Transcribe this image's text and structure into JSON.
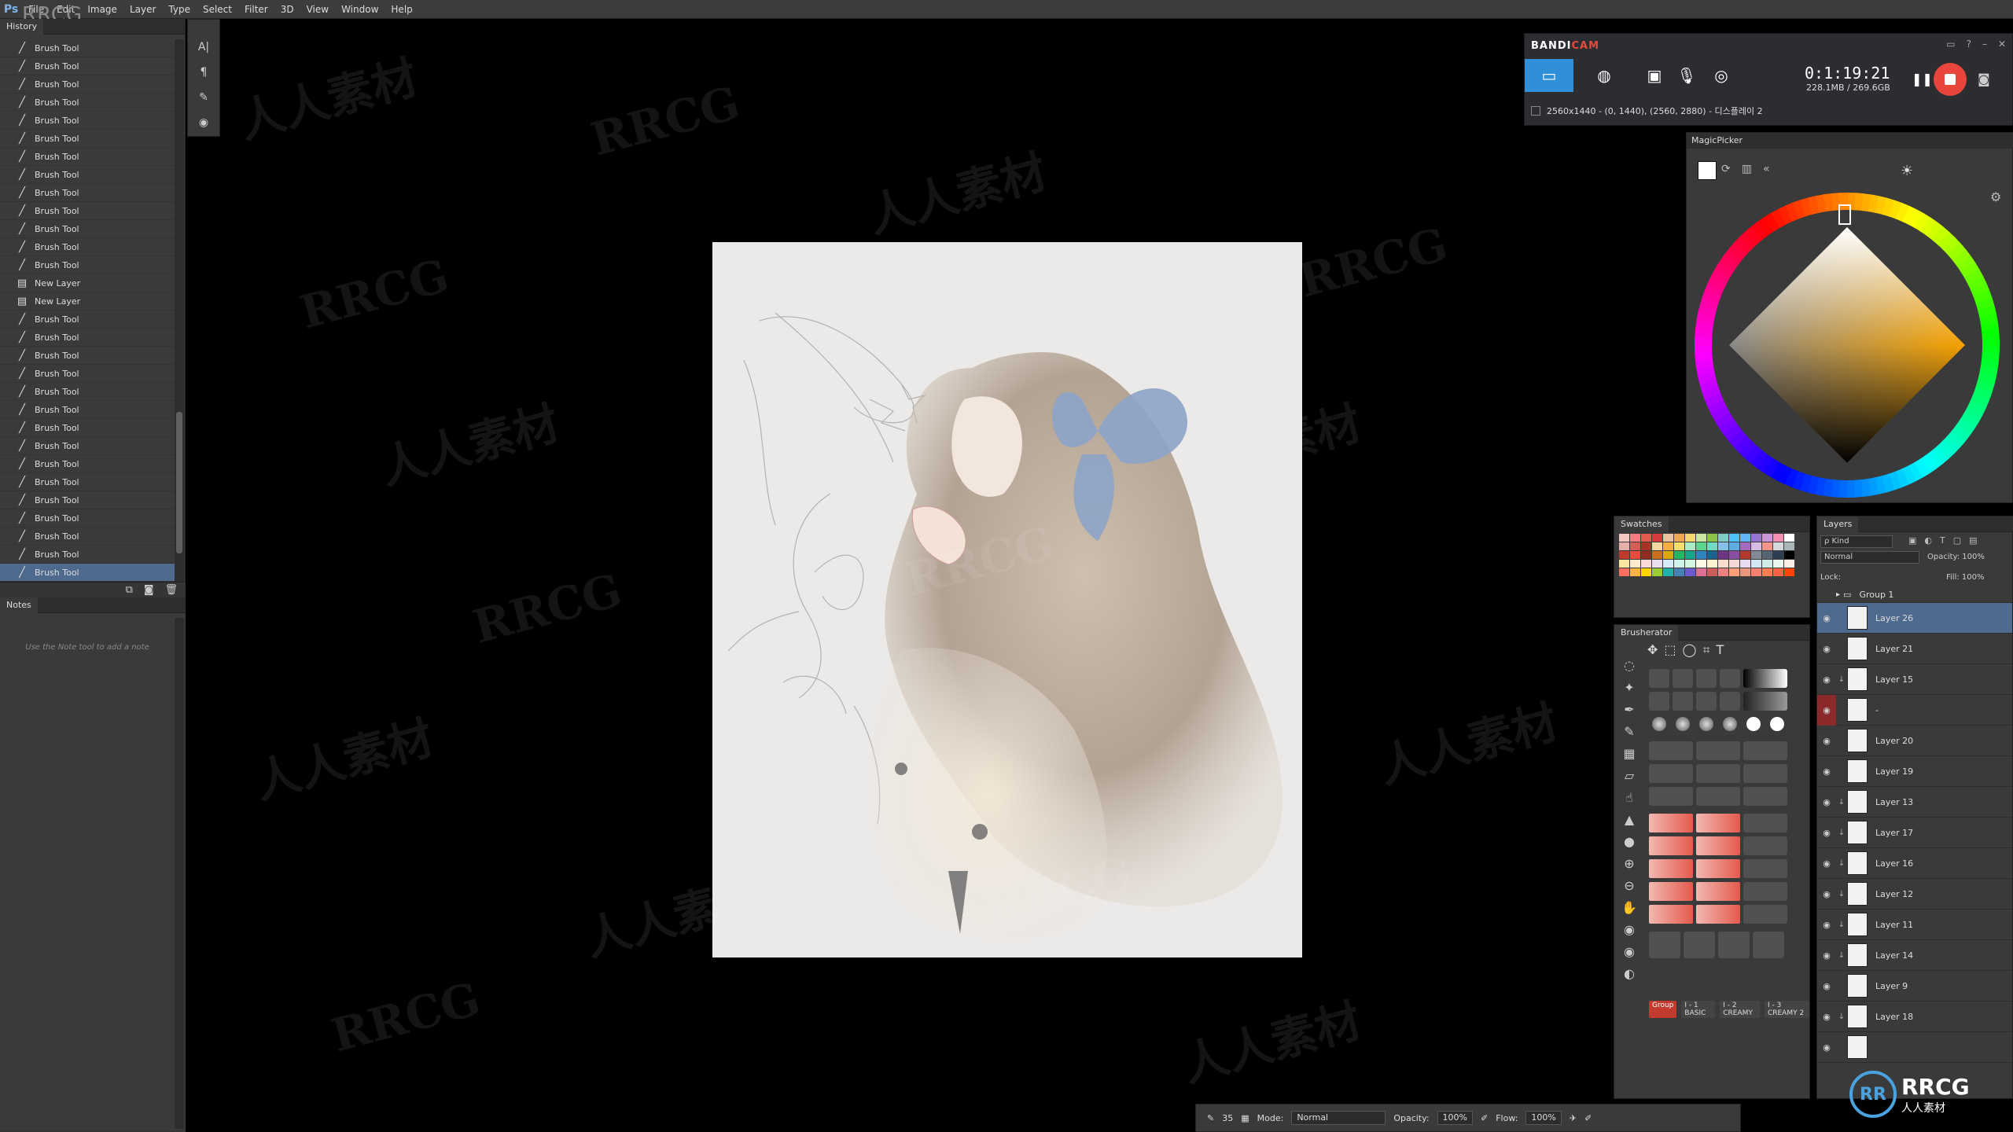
{
  "app": {
    "logo": "Ps",
    "watermark_small": "RRCG"
  },
  "menu": [
    "File",
    "Edit",
    "Image",
    "Layer",
    "Type",
    "Select",
    "Filter",
    "3D",
    "View",
    "Window",
    "Help"
  ],
  "history": {
    "tab_label": "History",
    "items": [
      {
        "label": "Brush Tool",
        "icon": "brush-icon"
      },
      {
        "label": "Brush Tool",
        "icon": "brush-icon"
      },
      {
        "label": "Brush Tool",
        "icon": "brush-icon"
      },
      {
        "label": "Brush Tool",
        "icon": "brush-icon"
      },
      {
        "label": "Brush Tool",
        "icon": "brush-icon"
      },
      {
        "label": "Brush Tool",
        "icon": "brush-icon"
      },
      {
        "label": "Brush Tool",
        "icon": "brush-icon"
      },
      {
        "label": "Brush Tool",
        "icon": "brush-icon"
      },
      {
        "label": "Brush Tool",
        "icon": "brush-icon"
      },
      {
        "label": "Brush Tool",
        "icon": "brush-icon"
      },
      {
        "label": "Brush Tool",
        "icon": "brush-icon"
      },
      {
        "label": "Brush Tool",
        "icon": "brush-icon"
      },
      {
        "label": "Brush Tool",
        "icon": "brush-icon"
      },
      {
        "label": "New Layer",
        "icon": "layer-icon"
      },
      {
        "label": "New Layer",
        "icon": "layer-icon"
      },
      {
        "label": "Brush Tool",
        "icon": "brush-icon"
      },
      {
        "label": "Brush Tool",
        "icon": "brush-icon"
      },
      {
        "label": "Brush Tool",
        "icon": "brush-icon"
      },
      {
        "label": "Brush Tool",
        "icon": "brush-icon"
      },
      {
        "label": "Brush Tool",
        "icon": "brush-icon"
      },
      {
        "label": "Brush Tool",
        "icon": "brush-icon"
      },
      {
        "label": "Brush Tool",
        "icon": "brush-icon"
      },
      {
        "label": "Brush Tool",
        "icon": "brush-icon"
      },
      {
        "label": "Brush Tool",
        "icon": "brush-icon"
      },
      {
        "label": "Brush Tool",
        "icon": "brush-icon"
      },
      {
        "label": "Brush Tool",
        "icon": "brush-icon"
      },
      {
        "label": "Brush Tool",
        "icon": "brush-icon"
      },
      {
        "label": "Brush Tool",
        "icon": "brush-icon"
      },
      {
        "label": "Brush Tool",
        "icon": "brush-icon"
      },
      {
        "label": "Brush Tool",
        "icon": "brush-icon",
        "selected": true
      }
    ]
  },
  "notes": {
    "tab_label": "Notes",
    "hint": "Use the Note tool to add a note"
  },
  "bandicam": {
    "title_a": "BANDI",
    "title_b": "CAM",
    "time": "0:1:19:21",
    "size": "228.1MB / 269.6GB",
    "capture_info": "2560x1440 - (0, 1440), (2560, 2880) - 디스플레이 2"
  },
  "magicpicker": {
    "tab_label": "MagicPicker"
  },
  "swatches": {
    "tab_label": "Swatches",
    "colors": [
      "#f4c7c3",
      "#f08080",
      "#e45a4c",
      "#d63c3c",
      "#e8c4a0",
      "#f2a65a",
      "#f5d76e",
      "#c8e6a0",
      "#8bc34a",
      "#80cbc4",
      "#4fc3f7",
      "#64b5f6",
      "#9575cd",
      "#ce93d8",
      "#f48fb1",
      "#ffffff",
      "#e6b0aa",
      "#cd6155",
      "#a93226",
      "#fad7a0",
      "#f5b041",
      "#f7dc6f",
      "#abebc6",
      "#58d68d",
      "#76d7c4",
      "#85c1e9",
      "#5dade2",
      "#a569bd",
      "#d7bde2",
      "#f1948a",
      "#d5d8dc",
      "#aab7b8",
      "#c0392b",
      "#e74c3c",
      "#922b21",
      "#ca6f1e",
      "#d4ac0d",
      "#28b463",
      "#17a589",
      "#2e86c1",
      "#1f618d",
      "#6c3483",
      "#884ea0",
      "#b03a2e",
      "#808b96",
      "#566573",
      "#2c3e50",
      "#000000",
      "#f9e79f",
      "#fdebd0",
      "#fadbd8",
      "#ebdef0",
      "#d6eaf8",
      "#d1f2eb",
      "#d5f5e3",
      "#fef9e7",
      "#fcf3cf",
      "#f6ddcc",
      "#f2d7d5",
      "#e8daef",
      "#d4e6f1",
      "#d0ece7",
      "#e9f7ef",
      "#fbeee6",
      "#ff6f61",
      "#ffb347",
      "#ffd700",
      "#9acd32",
      "#20b2aa",
      "#4682b4",
      "#6a5acd",
      "#db7093",
      "#cd5c5c",
      "#f08080",
      "#ffa07a",
      "#e9967a",
      "#fa8072",
      "#ff7f50",
      "#ff6347",
      "#ff4500"
    ]
  },
  "brusherator": {
    "tab_label": "Brusherator",
    "labels": {
      "group": "Group",
      "basic": "I - 1 BASIC",
      "creamy": "I - 2 CREAMY",
      "creamy2": "I - 3 CREAMY 2"
    }
  },
  "layers": {
    "tab_label": "Layers",
    "kind": "ρ Kind",
    "mode": "Normal",
    "opacity_label": "Opacity:",
    "opacity_value": "100%",
    "lock_label": "Lock:",
    "fill_label": "Fill:",
    "fill_value": "100%",
    "items": [
      {
        "name": "Group 1",
        "group": true
      },
      {
        "name": "Layer 26",
        "selected": true,
        "clip": ""
      },
      {
        "name": "Layer 21",
        "clip": ""
      },
      {
        "name": "Layer 15",
        "clip": "↓"
      },
      {
        "name": "-",
        "clip": "",
        "eye_red": true
      },
      {
        "name": "Layer 20",
        "clip": ""
      },
      {
        "name": "Layer 19",
        "clip": ""
      },
      {
        "name": "Layer 13",
        "clip": "↓"
      },
      {
        "name": "Layer 17",
        "clip": "↓"
      },
      {
        "name": "Layer 16",
        "clip": "↓"
      },
      {
        "name": "Layer 12",
        "clip": "↓"
      },
      {
        "name": "Layer 11",
        "clip": "↓"
      },
      {
        "name": "Layer 14",
        "clip": "↓"
      },
      {
        "name": "Layer 9",
        "clip": ""
      },
      {
        "name": "Layer 18",
        "clip": "↓"
      },
      {
        "name": "",
        "clip": ""
      }
    ]
  },
  "options": {
    "brush_size": "35",
    "mode_label": "Mode:",
    "mode_value": "Normal",
    "opacity_label": "Opacity:",
    "opacity_value": "100%",
    "flow_label": "Flow:",
    "flow_value": "100%"
  },
  "watermarks": [
    "RRCG",
    "人人素材"
  ],
  "logo": {
    "circle": "RR",
    "main": "RRCG",
    "sub": "人人素材"
  }
}
